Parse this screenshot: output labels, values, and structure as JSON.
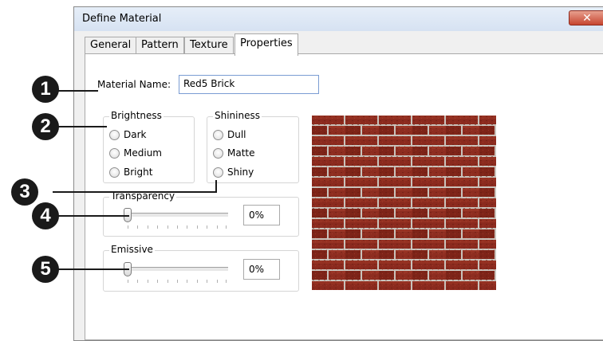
{
  "window": {
    "title": "Define Material",
    "close_glyph": "✕"
  },
  "tabs": [
    {
      "label": "General"
    },
    {
      "label": "Pattern"
    },
    {
      "label": "Texture"
    },
    {
      "label": "Properties"
    }
  ],
  "material_name": {
    "label": "Material Name:",
    "value": "Red5 Brick"
  },
  "brightness": {
    "title": "Brightness",
    "options": [
      "Dark",
      "Medium",
      "Bright"
    ]
  },
  "shininess": {
    "title": "Shininess",
    "options": [
      "Dull",
      "Matte",
      "Shiny"
    ]
  },
  "transparency": {
    "title": "Transparency",
    "value": "0%",
    "level": 0
  },
  "emissive": {
    "title": "Emissive",
    "value": "0%",
    "level": 0
  },
  "callouts": [
    "1",
    "2",
    "3",
    "4",
    "5"
  ],
  "colors": {
    "brick": "#8b2a1e",
    "mortar": "#c9c2bb",
    "callout": "#1a1a1a"
  },
  "preview": {
    "icon": "brick-texture"
  }
}
